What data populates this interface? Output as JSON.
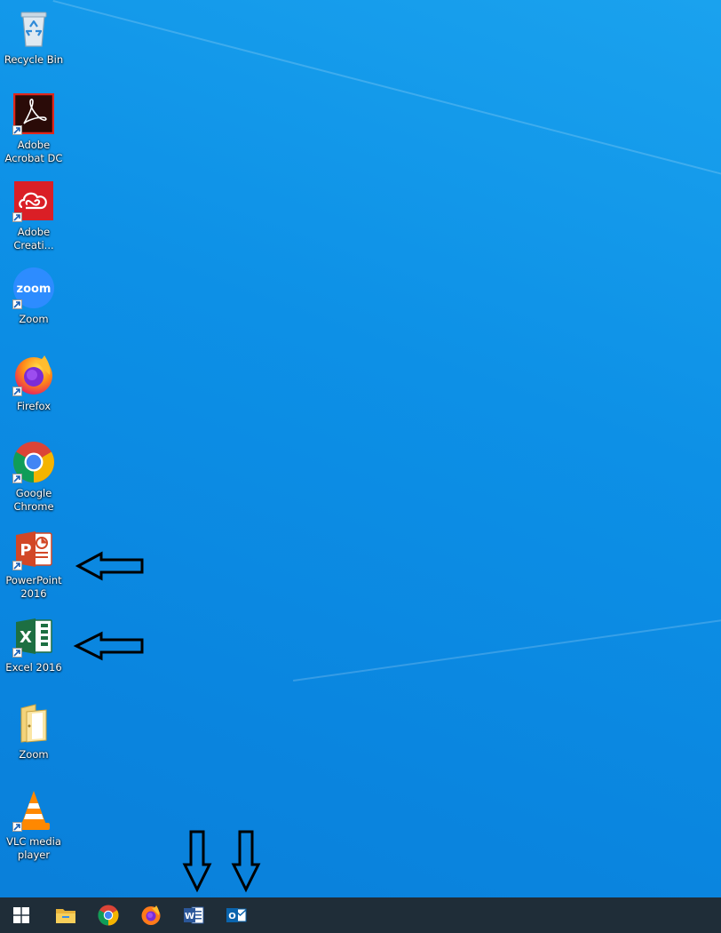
{
  "desktop": {
    "icons": [
      {
        "label": "Recycle Bin",
        "icon": "recycle-bin-icon"
      },
      {
        "label": "Adobe\nAcrobat DC",
        "icon": "adobe-acrobat-icon"
      },
      {
        "label": "Adobe\nCreati...",
        "icon": "adobe-creative-cloud-icon"
      },
      {
        "label": "Zoom",
        "icon": "zoom-icon",
        "glyph": "zoom"
      },
      {
        "label": "Firefox",
        "icon": "firefox-icon"
      },
      {
        "label": "Google\nChrome",
        "icon": "chrome-icon"
      },
      {
        "label": "PowerPoint\n2016",
        "icon": "powerpoint-icon",
        "glyph": "P"
      },
      {
        "label": "Excel 2016",
        "icon": "excel-icon",
        "glyph": "X"
      },
      {
        "label": "Zoom",
        "icon": "folder-icon"
      },
      {
        "label": "VLC media\nplayer",
        "icon": "vlc-icon"
      }
    ]
  },
  "taskbar": {
    "items": [
      {
        "icon": "windows-start-icon"
      },
      {
        "icon": "file-explorer-icon"
      },
      {
        "icon": "chrome-icon"
      },
      {
        "icon": "firefox-icon"
      },
      {
        "icon": "word-icon",
        "glyph": "W"
      },
      {
        "icon": "outlook-icon",
        "glyph": "O"
      }
    ]
  },
  "colors": {
    "taskbar": "#1f2d38",
    "acrobat": "#b30b00",
    "creative_cloud": "#da1f26",
    "zoom": "#2d8cff",
    "powerpoint": "#d24726",
    "excel": "#1d6f42",
    "word": "#2b579a",
    "outlook": "#0a64ad"
  }
}
